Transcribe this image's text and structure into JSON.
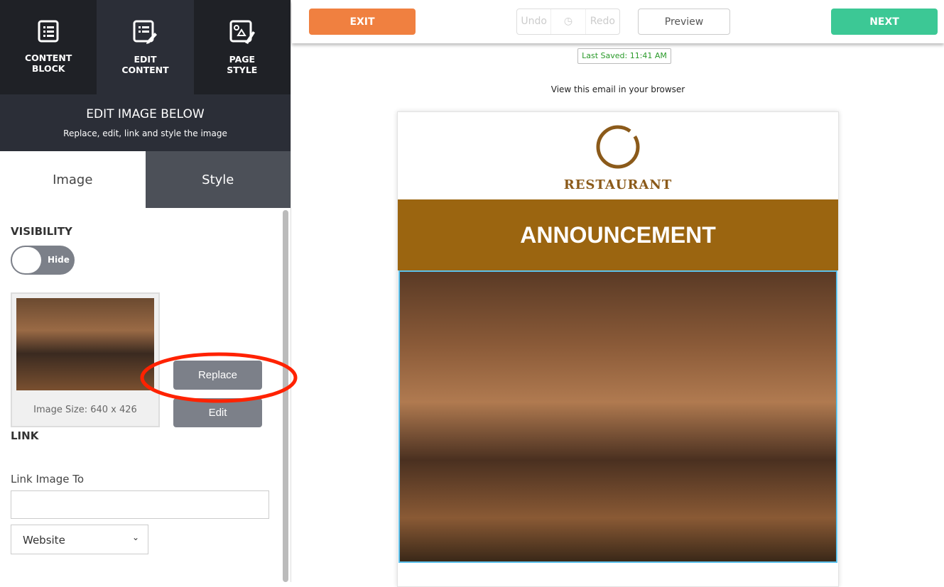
{
  "sidebar": {
    "nav": [
      {
        "label1": "CONTENT",
        "label2": "BLOCK",
        "icon": "list-icon"
      },
      {
        "label1": "EDIT",
        "label2": "CONTENT",
        "icon": "edit-list-icon"
      },
      {
        "label1": "PAGE",
        "label2": "STYLE",
        "icon": "page-style-icon"
      }
    ],
    "header": {
      "title": "EDIT IMAGE BELOW",
      "subtitle": "Replace, edit, link and style the image"
    },
    "tabs": [
      "Image",
      "Style"
    ],
    "visibility": {
      "label": "VISIBILITY",
      "toggle": "Hide"
    },
    "image": {
      "size": "Image Size: 640 x 426",
      "replace": "Replace",
      "edit": "Edit"
    },
    "link": {
      "label": "LINK",
      "field_label": "Link Image To",
      "value": "",
      "type": "Website"
    }
  },
  "toolbar": {
    "exit": "EXIT",
    "undo": "Undo",
    "redo": "Redo",
    "preview": "Preview",
    "next": "NEXT"
  },
  "status": {
    "last_saved": "Last Saved: 11:41 AM"
  },
  "email": {
    "view_link": "View this email in your browser",
    "brand": "RESTAURANT",
    "banner": "ANNOUNCEMENT"
  },
  "colors": {
    "exit": "#f08040",
    "next": "#3cc895",
    "banner": "#9b6510",
    "highlight": "#ff2200"
  }
}
